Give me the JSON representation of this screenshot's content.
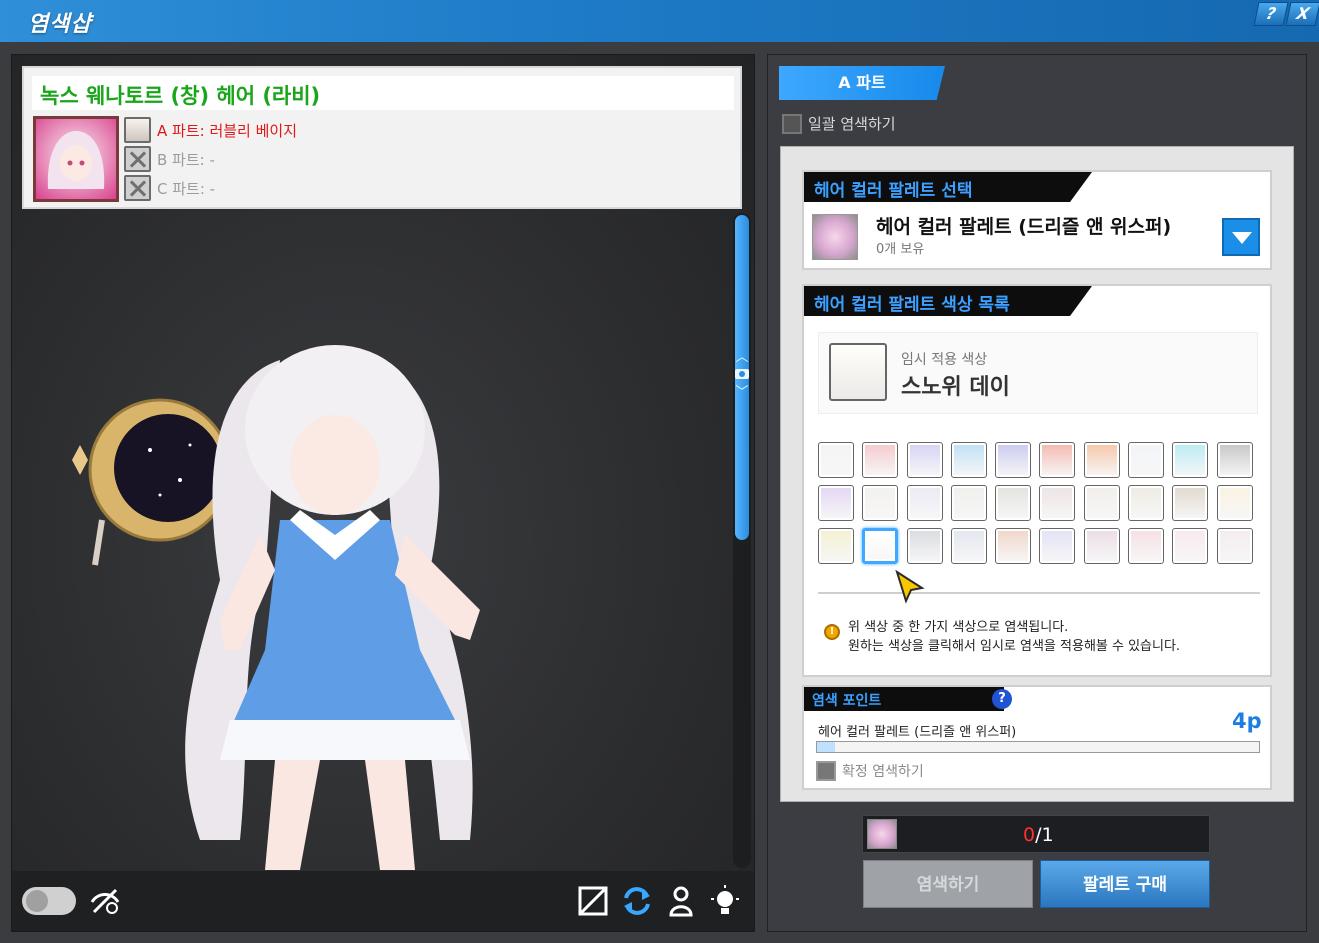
{
  "window": {
    "title": "염색샵",
    "help_label": "?",
    "close_label": "X"
  },
  "item": {
    "name": "녹스 웨나토르 (창) 헤어 (라비)",
    "parts": [
      {
        "label": "A 파트: 러블리 베이지",
        "active": true
      },
      {
        "label": "B 파트: -",
        "active": false
      },
      {
        "label": "C 파트: -",
        "active": false
      }
    ]
  },
  "preview": {
    "camera_up": "︿",
    "camera_down": "﹀",
    "icons": [
      "hide-toggle-icon",
      "hide-accessory-icon",
      "no-background-icon",
      "rotate-icon",
      "pose-icon",
      "light-icon"
    ]
  },
  "tabs": {
    "active": "A 파트"
  },
  "bulk_dye_label": "일괄 염색하기",
  "palette_select": {
    "heading": "헤어 컬러 팔레트 선택",
    "name": "헤어 컬러 팔레트 (드리즐 앤 위스퍼)",
    "owned": "0개 보유"
  },
  "palette_colors": {
    "heading": "헤어 컬러 팔레트 색상 목록",
    "temp_label": "임시 적용 색상",
    "temp_name": "스노위 데이",
    "swatches": [
      "#f4f4f4",
      "#f6c9cc",
      "#d5d3f4",
      "#bfe0f4",
      "#c9c9f0",
      "#f4b8ae",
      "#f6c6a8",
      "#f1f4f8",
      "#b9ecf4",
      "#c6c6c6",
      "#e3d6f4",
      "#f3f1ee",
      "#ede9f4",
      "#eff0ec",
      "#e3e2de",
      "#ede3e3",
      "#f2efe9",
      "#eeebe4",
      "#e0d9cd",
      "#fbf3e2",
      "#f4f1cf",
      "#ffffff",
      "#d9dbe0",
      "#e2e6ee",
      "#f0d6c8",
      "#e2e2f6",
      "#ebdde6",
      "#f6dfe3",
      "#f8e8ef",
      "#f4ecef"
    ],
    "selected_index": 21,
    "notice_line1": "위 색상 중 한 가지 색상으로 염색됩니다.",
    "notice_line2": "원하는 색상을 클릭해서 임시로 염색을 적용해볼 수 있습니다."
  },
  "points": {
    "heading": "염색 포인트",
    "help": "?",
    "item": "헤어 컬러 팔레트 (드리즐 앤 위스퍼)",
    "value": "4p",
    "progress_fraction": 0.04,
    "confirm_label": "확정 염색하기"
  },
  "count": {
    "current": "0",
    "total": "/1"
  },
  "buttons": {
    "dye": "염색하기",
    "buy": "팔레트 구매"
  }
}
